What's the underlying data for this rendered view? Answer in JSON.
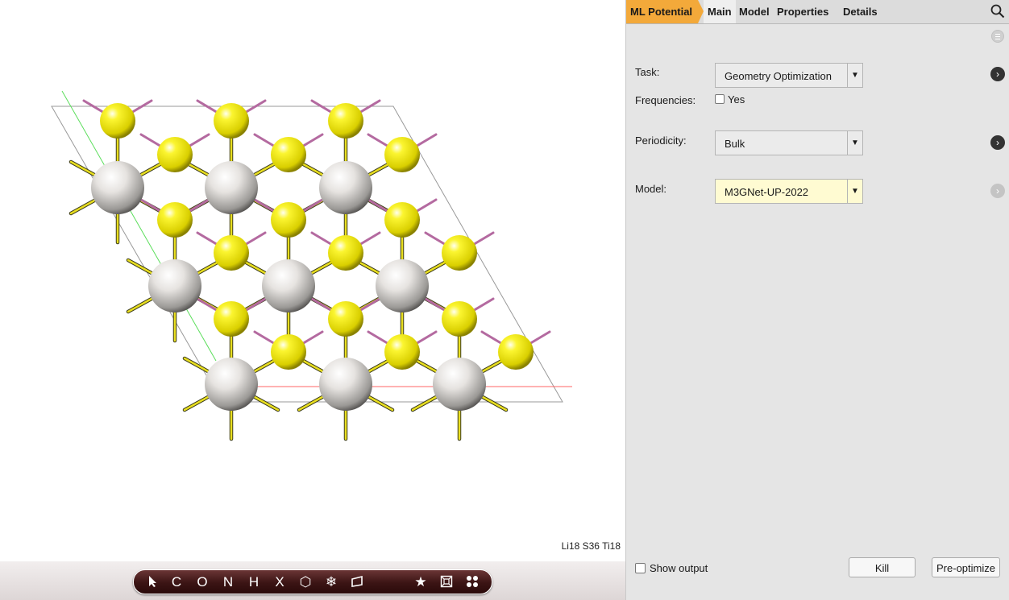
{
  "viewer": {
    "formula": "Li18 S36 Ti18"
  },
  "toolbar": {
    "items": [
      {
        "name": "select-tool",
        "glyph": ""
      },
      {
        "name": "carbon-tool",
        "glyph": "C"
      },
      {
        "name": "oxygen-tool",
        "glyph": "O"
      },
      {
        "name": "nitrogen-tool",
        "glyph": "N"
      },
      {
        "name": "hydrogen-tool",
        "glyph": "H"
      },
      {
        "name": "other-element-tool",
        "glyph": "X"
      },
      {
        "name": "ring-tool",
        "glyph": "⬡"
      },
      {
        "name": "freeze-tool",
        "glyph": "❄"
      },
      {
        "name": "plane-tool",
        "glyph": ""
      },
      {
        "name": "favorites-tool",
        "glyph": "★"
      },
      {
        "name": "crystal-tool",
        "glyph": ""
      },
      {
        "name": "fragments-tool",
        "glyph": ""
      }
    ]
  },
  "tabs": {
    "module": "ML Potential",
    "items": [
      "Main",
      "Model",
      "Properties",
      "Details"
    ],
    "current": "Main"
  },
  "form": {
    "task_label": "Task:",
    "task_value": "Geometry Optimization",
    "frequencies_label": "Frequencies:",
    "frequencies_option": "Yes",
    "periodicity_label": "Periodicity:",
    "periodicity_value": "Bulk",
    "model_label": "Model:",
    "model_value": "M3GNet-UP-2022"
  },
  "footer": {
    "show_output": "Show output",
    "kill": "Kill",
    "preoptimize": "Pre-optimize"
  },
  "colors": {
    "module_tab": "#f3a93a",
    "sulfur": "#f5f000",
    "titanium": "#c8c8c8",
    "lithium_bond": "#c080b0",
    "model_field": "#fffbd2"
  }
}
